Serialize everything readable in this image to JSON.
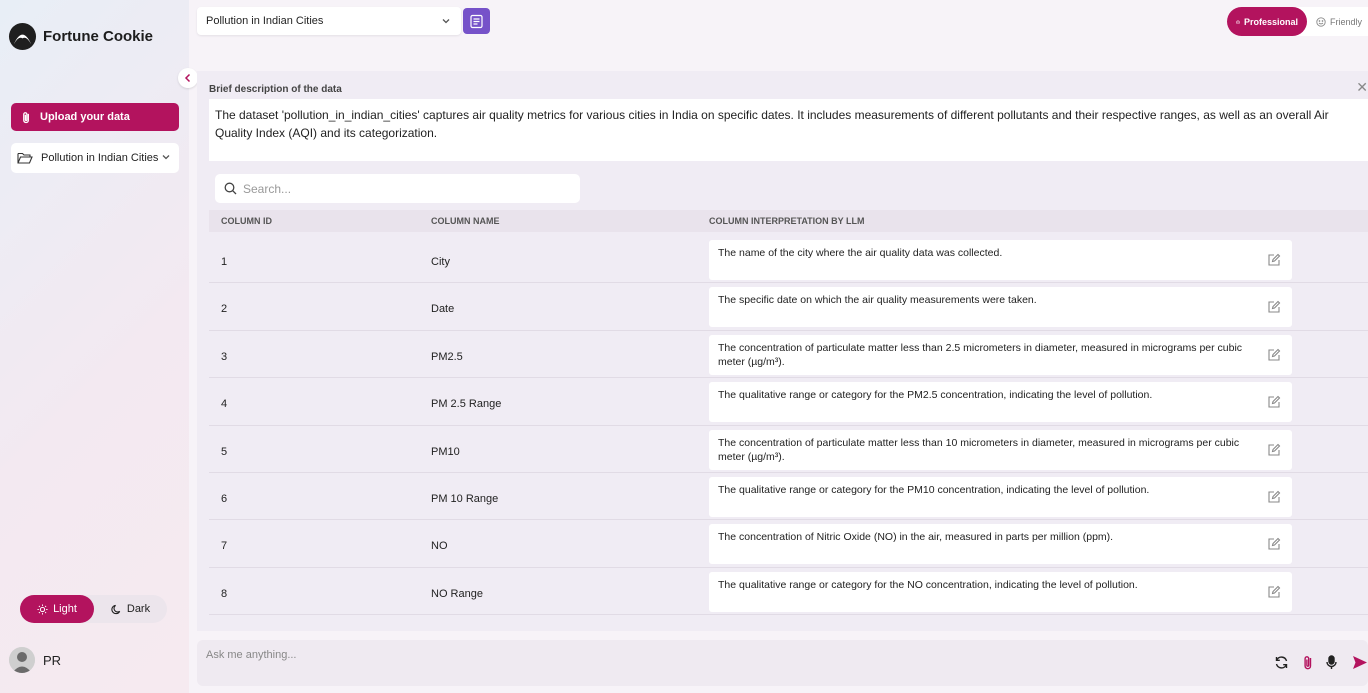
{
  "app": {
    "name": "Fortune Cookie"
  },
  "sidebar": {
    "upload_label": "Upload your data",
    "dataset_label": "Pollution in Indian Cities",
    "theme": {
      "light_label": "Light",
      "dark_label": "Dark",
      "selected": "Light"
    },
    "user_initials": "PR"
  },
  "topbar": {
    "dataset_select_value": "Pollution in Indian Cities",
    "mode": {
      "professional_label": "Professional",
      "friendly_label": "Friendly",
      "selected": "Professional"
    }
  },
  "description": {
    "title": "Brief description of the data",
    "text": "The dataset 'pollution_in_indian_cities' captures air quality metrics for various cities in India on specific dates. It includes measurements of different pollutants and their respective ranges, as well as an overall Air Quality Index (AQI) and its categorization."
  },
  "search": {
    "placeholder": "Search..."
  },
  "table": {
    "headers": {
      "id": "COLUMN ID",
      "name": "COLUMN NAME",
      "interp": "COLUMN INTERPRETATION BY LLM"
    },
    "rows": [
      {
        "id": "1",
        "name": "City",
        "interp": "The name of the city where the air quality data was collected."
      },
      {
        "id": "2",
        "name": "Date",
        "interp": "The specific date on which the air quality measurements were taken."
      },
      {
        "id": "3",
        "name": "PM2.5",
        "interp": "The concentration of particulate matter less than 2.5 micrometers in diameter, measured in micrograms per cubic meter (µg/m³)."
      },
      {
        "id": "4",
        "name": "PM 2.5 Range",
        "interp": "The qualitative range or category for the PM2.5 concentration, indicating the level of pollution."
      },
      {
        "id": "5",
        "name": "PM10",
        "interp": "The concentration of particulate matter less than 10 micrometers in diameter, measured in micrograms per cubic meter (µg/m³)."
      },
      {
        "id": "6",
        "name": "PM 10 Range",
        "interp": "The qualitative range or category for the PM10 concentration, indicating the level of pollution."
      },
      {
        "id": "7",
        "name": "NO",
        "interp": "The concentration of Nitric Oxide (NO) in the air, measured in parts per million (ppm)."
      },
      {
        "id": "8",
        "name": "NO Range",
        "interp": "The qualitative range or category for the NO concentration, indicating the level of pollution."
      }
    ]
  },
  "chat": {
    "placeholder": "Ask me anything..."
  },
  "colors": {
    "accent": "#b3135e",
    "doc_button": "#7652c9"
  }
}
